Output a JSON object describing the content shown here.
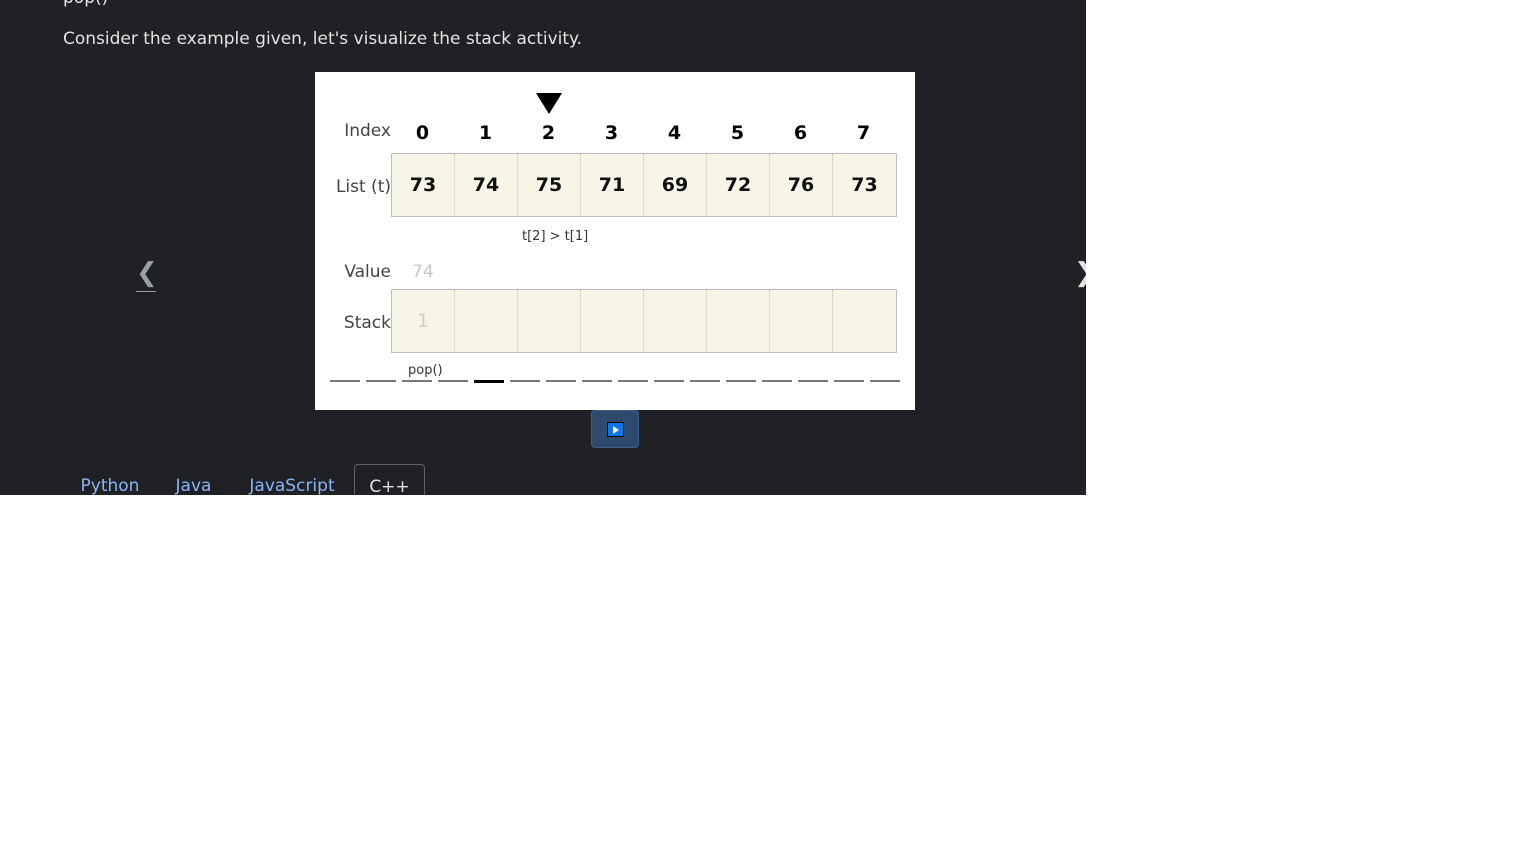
{
  "top_text_cut": "pop()",
  "intro_text": "Consider the example given, let's visualize the stack activity.",
  "nav": {
    "prev_icon": "❮",
    "next_icon": "❯"
  },
  "viz": {
    "row_labels": {
      "index": "Index",
      "list": "List (t)",
      "value": "Value",
      "stack": "Stack"
    },
    "indices": [
      "0",
      "1",
      "2",
      "3",
      "4",
      "5",
      "6",
      "7"
    ],
    "pointer_index": 2,
    "list": [
      "73",
      "74",
      "75",
      "71",
      "69",
      "72",
      "76",
      "73"
    ],
    "comparison": "t[2] > t[1]",
    "value": "74",
    "stack": [
      "1",
      "",
      "",
      "",
      "",
      "",
      "",
      ""
    ],
    "step_label": "pop()",
    "progress": {
      "total_steps": 16,
      "current_step": 5
    }
  },
  "play_button": {
    "icon": "play-icon"
  },
  "tabs": [
    {
      "label": "Python",
      "selected": false
    },
    {
      "label": "Java",
      "selected": false
    },
    {
      "label": "JavaScript",
      "selected": false
    },
    {
      "label": "C++",
      "selected": true
    }
  ]
}
